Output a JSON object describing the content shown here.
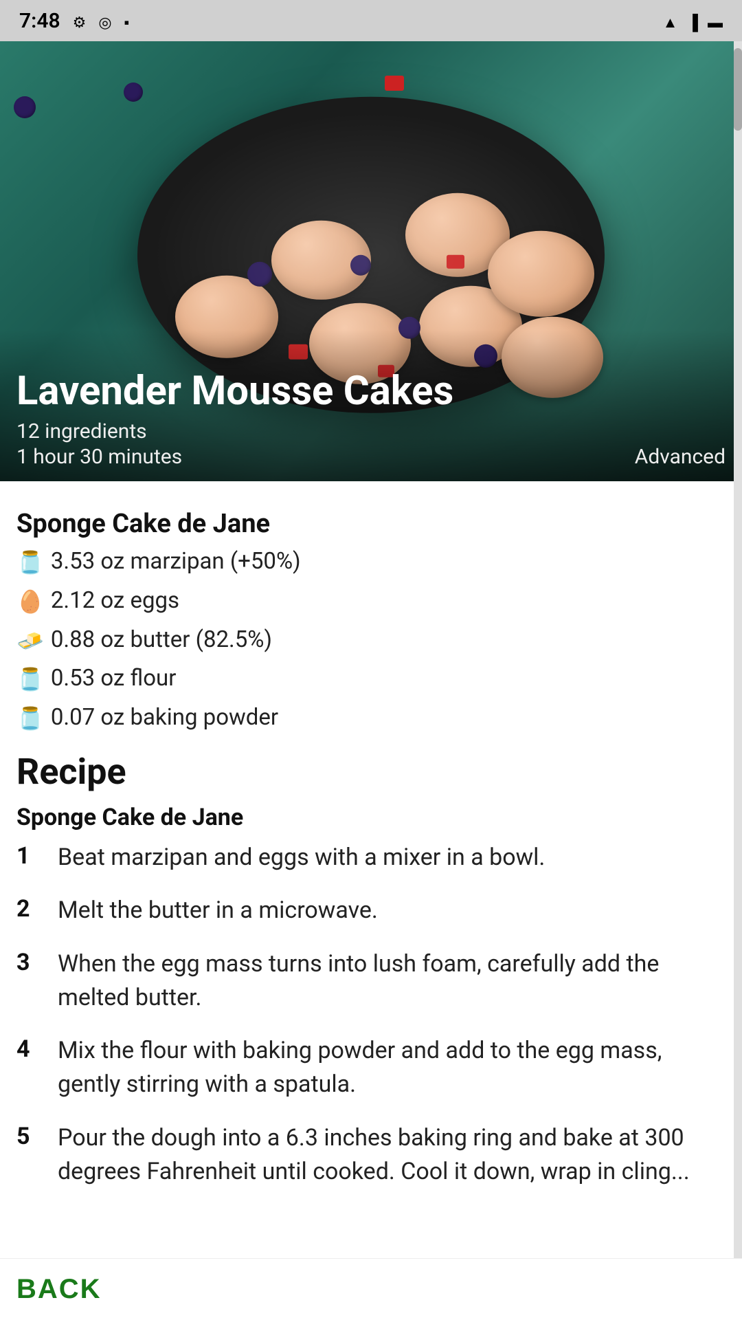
{
  "statusBar": {
    "time": "7:48",
    "icons": [
      "gear",
      "circle",
      "card",
      "wifi",
      "signal",
      "battery"
    ]
  },
  "hero": {
    "title": "Lavender Mousse Cakes",
    "ingredientsCount": "12 ingredients",
    "time": "1 hour 30 minutes",
    "difficulty": "Advanced"
  },
  "ingredientsSection": {
    "title": "Sponge Cake de Jane",
    "items": [
      {
        "icon": "🫙",
        "text": "3.53 oz marzipan (+50%)"
      },
      {
        "icon": "🥚",
        "text": "2.12 oz eggs"
      },
      {
        "icon": "🧈",
        "text": "0.88 oz butter (82.5%)"
      },
      {
        "icon": "🫙",
        "text": "0.53 oz flour"
      },
      {
        "icon": "🫙",
        "text": "0.07 oz baking powder"
      }
    ]
  },
  "recipeSection": {
    "heading": "Recipe",
    "subsectionTitle": "Sponge Cake de Jane",
    "steps": [
      {
        "number": "1",
        "text": "Beat marzipan and eggs with a mixer in a bowl."
      },
      {
        "number": "2",
        "text": "Melt the butter in a microwave."
      },
      {
        "number": "3",
        "text": "When the egg mass turns into lush foam, carefully add the melted butter."
      },
      {
        "number": "4",
        "text": "Mix the flour with baking powder and add to the egg mass, gently stirring with a spatula."
      },
      {
        "number": "5",
        "text": "Pour the dough into a 6.3 inches baking ring and bake at 300 degrees Fahrenheit until cooked. Cool it down, wrap in cling..."
      }
    ]
  },
  "bottomBar": {
    "backLabel": "BACK"
  }
}
